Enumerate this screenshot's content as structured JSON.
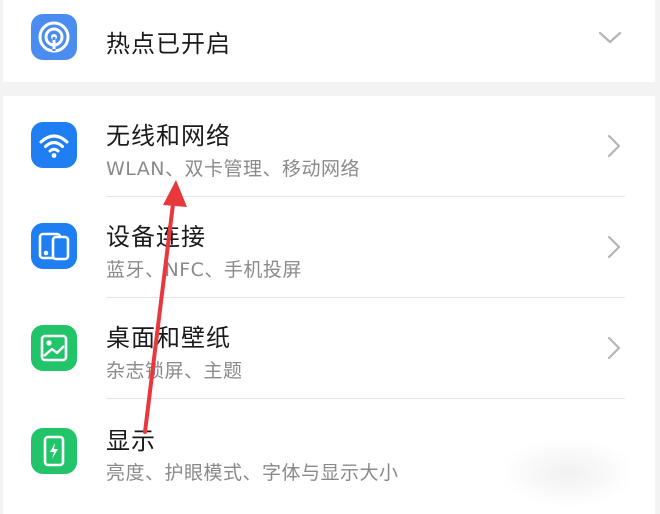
{
  "hotspot": {
    "title": "热点已开启",
    "icon": "hotspot-icon",
    "indicator": "chevron-down-icon"
  },
  "settings": [
    {
      "title": "无线和网络",
      "subtitle": "WLAN、双卡管理、移动网络",
      "icon": "wifi-icon",
      "icon_color": "#1e7ef2"
    },
    {
      "title": "设备连接",
      "subtitle": "蓝牙、NFC、手机投屏",
      "icon": "device-connection-icon",
      "icon_color": "#1e7ef2"
    },
    {
      "title": "桌面和壁纸",
      "subtitle": "杂志锁屏、主题",
      "icon": "wallpaper-icon",
      "icon_color": "#22c46a"
    },
    {
      "title": "显示",
      "subtitle": "亮度、护眼模式、字体与显示大小",
      "icon": "display-icon",
      "icon_color": "#22c46a"
    }
  ],
  "annotation": {
    "type": "red-arrow",
    "points_to": "无线和网络",
    "color": "#e8383b"
  }
}
